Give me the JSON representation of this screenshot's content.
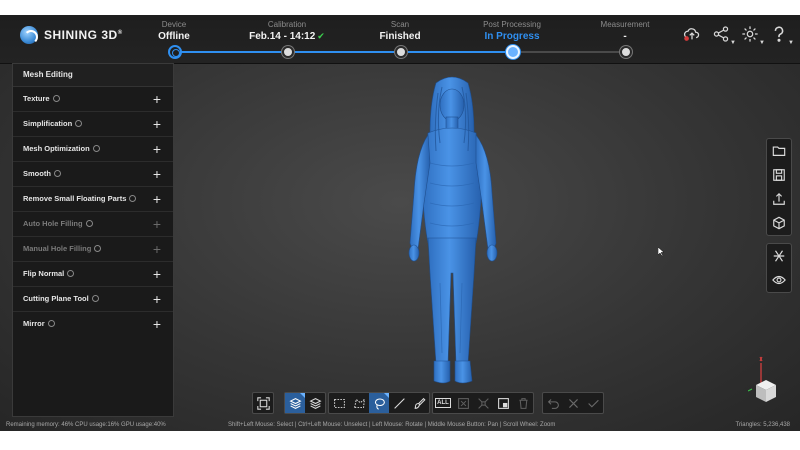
{
  "brand": {
    "name": "SHINING 3D",
    "mark": "®",
    "accent": "#2f8ff0"
  },
  "steps": [
    {
      "title": "Device",
      "value": "Offline",
      "check": ""
    },
    {
      "title": "Calibration",
      "value": "Feb.14 - 14:12",
      "check": "✔"
    },
    {
      "title": "Scan",
      "value": "Finished",
      "check": ""
    },
    {
      "title": "Post Processing",
      "value": "In Progress",
      "check": ""
    },
    {
      "title": "Measurement",
      "value": "-",
      "check": ""
    }
  ],
  "header_icons": [
    "cloud-upload-icon",
    "share-icon",
    "settings-icon",
    "help-icon"
  ],
  "panel": {
    "title": "Mesh Editing",
    "items": [
      {
        "label": "Texture",
        "enabled": true
      },
      {
        "label": "Simplification",
        "enabled": true
      },
      {
        "label": "Mesh Optimization",
        "enabled": true
      },
      {
        "label": "Smooth",
        "enabled": true
      },
      {
        "label": "Remove Small Floating Parts",
        "enabled": true
      },
      {
        "label": "Auto Hole Filling",
        "enabled": false
      },
      {
        "label": "Manual Hole Filling",
        "enabled": false
      },
      {
        "label": "Flip Normal",
        "enabled": true
      },
      {
        "label": "Cutting Plane Tool",
        "enabled": true
      },
      {
        "label": "Mirror",
        "enabled": true
      }
    ],
    "plus": "+"
  },
  "bottom_toolbar": {
    "all_label": "ALL"
  },
  "status": {
    "left": "Remaining memory: 46% CPU usage:16% GPU usage:40%",
    "center": "Shift+Left Mouse: Select | Ctrl+Left Mouse: Unselect | Left Mouse: Rotate | Middle Mouse Button: Pan | Scroll Wheel: Zoom",
    "right": "Triangles: 5,236,438"
  }
}
